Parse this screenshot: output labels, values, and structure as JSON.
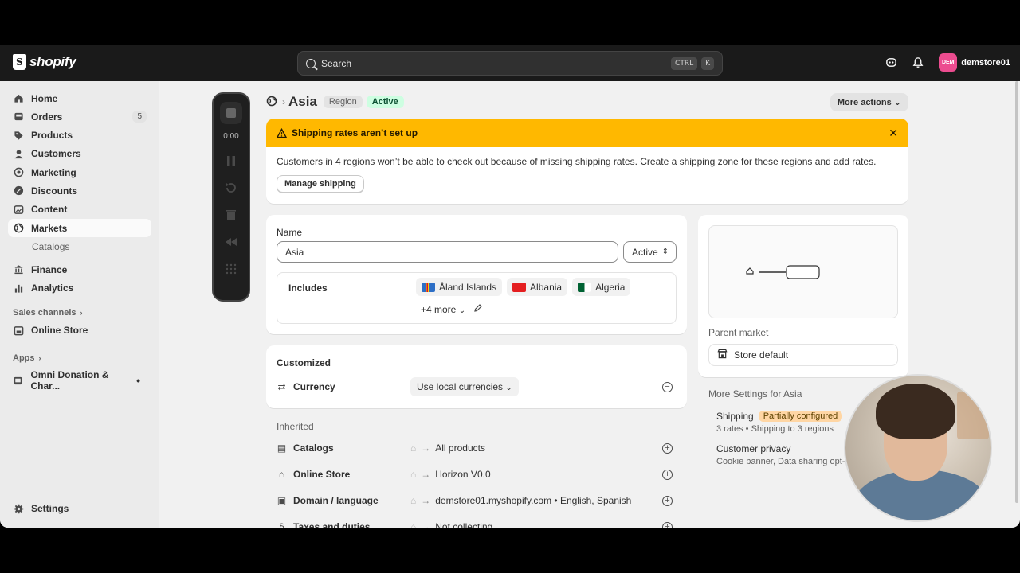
{
  "topbar": {
    "brand": "shopify",
    "search_placeholder": "Search",
    "kbd1": "CTRL",
    "kbd2": "K",
    "avatar_initials": "DEM",
    "store_name": "demstore01"
  },
  "sidebar": {
    "items": [
      {
        "label": "Home",
        "icon": "home-icon"
      },
      {
        "label": "Orders",
        "icon": "orders-icon",
        "badge": "5"
      },
      {
        "label": "Products",
        "icon": "tag-icon"
      },
      {
        "label": "Customers",
        "icon": "person-icon"
      },
      {
        "label": "Marketing",
        "icon": "target-icon"
      },
      {
        "label": "Discounts",
        "icon": "discount-icon"
      },
      {
        "label": "Content",
        "icon": "content-icon"
      },
      {
        "label": "Markets",
        "icon": "globe-icon"
      }
    ],
    "sub_catalogs": "Catalogs",
    "finance": "Finance",
    "analytics": "Analytics",
    "sales_channels": "Sales channels",
    "online_store": "Online Store",
    "apps": "Apps",
    "app_item": "Omni Donation & Char...",
    "settings": "Settings"
  },
  "recorder": {
    "time": "0:00"
  },
  "header": {
    "title": "Asia",
    "tag_region": "Region",
    "tag_status": "Active",
    "more_actions": "More actions"
  },
  "banner": {
    "title": "Shipping rates aren’t set up",
    "body": "Customers in 4 regions won’t be able to check out because of missing shipping rates. Create a shipping zone for these regions and add rates.",
    "button": "Manage shipping"
  },
  "form": {
    "name_label": "Name",
    "name_value": "Asia",
    "status_value": "Active",
    "includes_label": "Includes",
    "countries": [
      {
        "name": "Åland Islands",
        "color": "#2d6fc6"
      },
      {
        "name": "Albania",
        "color": "#e41e20"
      },
      {
        "name": "Algeria",
        "color": "#006233"
      }
    ],
    "more": "+4 more"
  },
  "customized": {
    "title": "Customized",
    "currency_label": "Currency",
    "currency_value": "Use local currencies"
  },
  "inherited": {
    "title": "Inherited",
    "rows": [
      {
        "name": "Catalogs",
        "value": "All products"
      },
      {
        "name": "Online Store",
        "value": "Horizon V0.0"
      },
      {
        "name": "Domain / language",
        "value": "demstore01.myshopify.com • English, Spanish"
      },
      {
        "name": "Taxes and duties",
        "value": "Not collecting"
      }
    ]
  },
  "side": {
    "parent_market_label": "Parent market",
    "parent_market_value": "Store default",
    "more_settings_title": "More Settings for Asia",
    "shipping_title": "Shipping",
    "shipping_badge": "Partially configured",
    "shipping_desc": "3 rates • Shipping to 3 regions",
    "privacy_title": "Customer privacy",
    "privacy_desc": "Cookie banner, Data sharing opt-o"
  }
}
